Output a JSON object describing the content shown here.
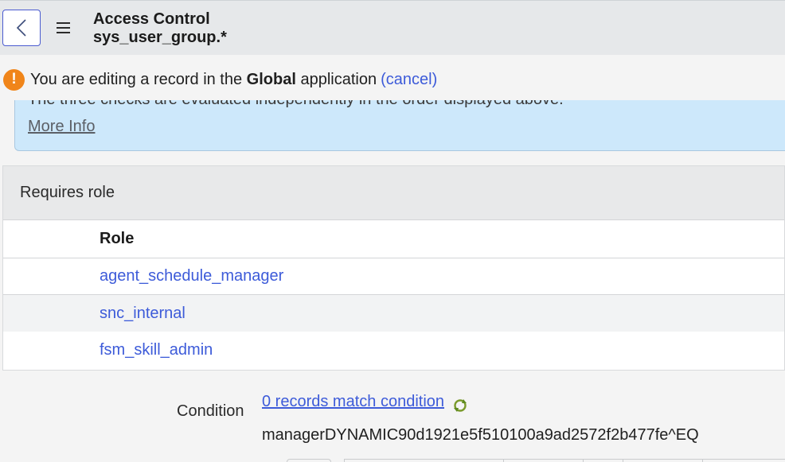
{
  "header": {
    "title": "Access Control",
    "subtitle": "sys_user_group.*"
  },
  "notice": {
    "prefix": "You are editing a record in the ",
    "application": "Global",
    "suffix": " application",
    "cancel_label": "(cancel)"
  },
  "info_box": {
    "clipped_text": "The three checks are evaluated independently in the order displayed above.",
    "more_info_label": "More Info"
  },
  "requires_role": {
    "section_title": "Requires role",
    "column_header": "Role",
    "rows": [
      "agent_schedule_manager",
      "snc_internal",
      "fsm_skill_admin"
    ]
  },
  "condition": {
    "label": "Condition",
    "records_link": "0 records match condition",
    "value": "managerDYNAMIC90d1921e5f510100a9ad2572f2b477fe^EQ"
  },
  "colors": {
    "accent": "#3d5bd9",
    "warning": "#f0851a",
    "info_background": "#cde8fb"
  }
}
